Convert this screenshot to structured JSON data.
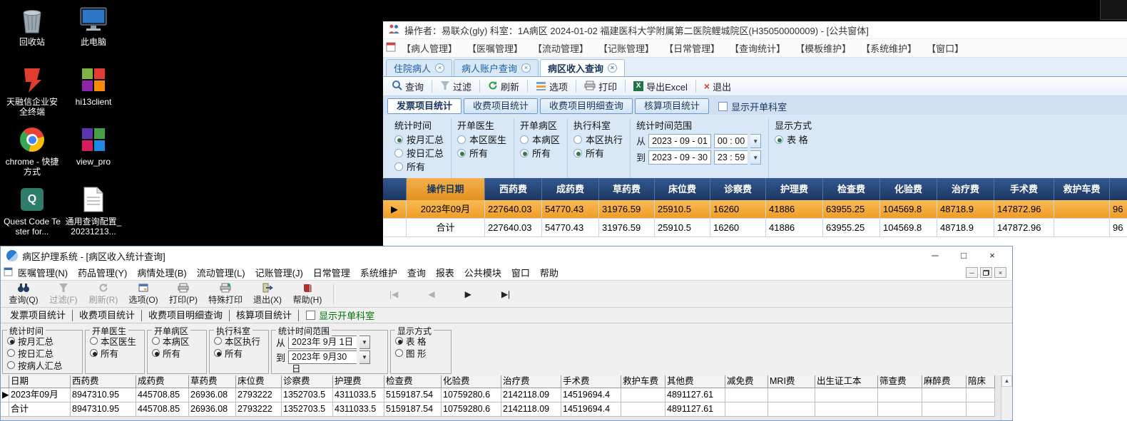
{
  "colors": {
    "header_navy": "#1c3763",
    "highlight_orange": "#f5a733",
    "checkbox_green": "#007700",
    "tab_blue": "#1a5fa8",
    "desktop_background": "#000000"
  },
  "desktop": {
    "icons": [
      {
        "label": "回收站"
      },
      {
        "label": "此电脑"
      },
      {
        "label": "天融信企业安全终端"
      },
      {
        "label": "hi13client"
      },
      {
        "label": "chrome - 快捷方式"
      },
      {
        "label": "view_pro"
      },
      {
        "label": "Quest Code Tester for..."
      },
      {
        "label": "通用查询配置_20231213..."
      }
    ]
  },
  "top_window": {
    "title": "操作者：易联众(gly)  科室：1A病区  2024-01-02  福建医科大学附属第二医院鲤城院区(H35050000009) - [公共窗体]",
    "menu": [
      "【病人管理】",
      "【医嘱管理】",
      "【流动管理】",
      "【记账管理】",
      "【日常管理】",
      "【查询统计】",
      "【模板维护】",
      "【系统维护】",
      "【窗口】"
    ],
    "tabs": [
      {
        "label": "住院病人"
      },
      {
        "label": "病人账户查询"
      },
      {
        "label": "病区收入查询"
      }
    ],
    "active_tab": "病区收入查询",
    "toolbar": {
      "query": "查询",
      "filter": "过滤",
      "refresh": "刷新",
      "options": "选项",
      "print": "打印",
      "export": "导出Excel",
      "exit": "退出"
    },
    "subtabs": [
      "发票项目统计",
      "收费项目统计",
      "收费项目明细查询",
      "核算项目统计"
    ],
    "active_subtab": "发票项目统计",
    "show_dept_label": "显示开单科室",
    "filters": {
      "stat_time": {
        "title": "统计时间",
        "options": [
          "按月汇总",
          "按日汇总",
          "所有"
        ],
        "selected": "按月汇总"
      },
      "doctor": {
        "title": "开单医生",
        "options": [
          "本区医生",
          "所有"
        ],
        "selected": "所有"
      },
      "ward": {
        "title": "开单病区",
        "options": [
          "本病区",
          "所有"
        ],
        "selected": "所有"
      },
      "exec_dept": {
        "title": "执行科室",
        "options": [
          "本区执行",
          "所有"
        ],
        "selected": "所有"
      },
      "time_range": {
        "title": "统计时间范围",
        "from_label": "从",
        "from_date": "2023 - 09 - 01",
        "from_time": "00 : 00",
        "to_label": "到",
        "to_date": "2023 - 09 - 30",
        "to_time": "23 : 59"
      },
      "display": {
        "title": "显示方式",
        "options": [
          "表   格"
        ],
        "selected": "表   格"
      }
    },
    "table": {
      "columns": [
        "操作日期",
        "西药费",
        "成药费",
        "草药费",
        "床位费",
        "诊察费",
        "护理费",
        "检查费",
        "化验费",
        "治疗费",
        "手术费",
        "救护车费",
        "其"
      ],
      "rows": [
        {
          "label": "2023年09月",
          "values": [
            "227640.03",
            "54770.43",
            "31976.59",
            "25910.5",
            "16260",
            "41886",
            "63955.25",
            "104569.8",
            "48718.9",
            "147872.96",
            "",
            "96"
          ]
        },
        {
          "label": "合计",
          "values": [
            "227640.03",
            "54770.43",
            "31976.59",
            "25910.5",
            "16260",
            "41886",
            "63955.25",
            "104569.8",
            "48718.9",
            "147872.96",
            "",
            "96"
          ]
        }
      ]
    }
  },
  "bottom_window": {
    "title": "病区护理系统 - [病区收入统计查询]",
    "menu": [
      "医嘱管理(N)",
      "药品管理(Y)",
      "病情处理(B)",
      "流动管理(L)",
      "记账管理(J)",
      "日常管理",
      "系统维护",
      "查询",
      "报表",
      "公共模块",
      "窗口",
      "帮助"
    ],
    "toolbar": [
      {
        "label": "查询(Q)",
        "enabled": true
      },
      {
        "label": "过滤(F)",
        "enabled": false
      },
      {
        "label": "刷新(R)",
        "enabled": false
      },
      {
        "label": "选项(O)",
        "enabled": true
      },
      {
        "label": "打印(P)",
        "enabled": true
      },
      {
        "label": "特殊打印",
        "enabled": true
      },
      {
        "label": "退出(X)",
        "enabled": true
      },
      {
        "label": "帮助(H)",
        "enabled": true
      }
    ],
    "subtabs": [
      "发票项目统计",
      "收费项目统计",
      "收费项目明细查询",
      "核算项目统计"
    ],
    "show_dept_label": "显示开单科室",
    "filters": {
      "stat_time": {
        "title": "统计时间",
        "options": [
          "按月汇总",
          "按日汇总",
          "按病人汇总"
        ],
        "selected": "按月汇总"
      },
      "doctor": {
        "title": "开单医生",
        "options": [
          "本区医生",
          "所有"
        ],
        "selected": "所有"
      },
      "ward": {
        "title": "开单病区",
        "options": [
          "本病区",
          "所有"
        ],
        "selected": "所有"
      },
      "exec_dept": {
        "title": "执行科室",
        "options": [
          "本区执行",
          "所有"
        ],
        "selected": "所有"
      },
      "time_range": {
        "title": "统计时间范围",
        "from_label": "从",
        "from_date": "2023年 9月 1日",
        "to_label": "到",
        "to_date": "2023年 9月30日"
      },
      "display": {
        "title": "显示方式",
        "options": [
          "表  格",
          "图  形"
        ],
        "selected": "表  格"
      }
    },
    "table": {
      "columns": [
        "日期",
        "西药费",
        "成药费",
        "草药费",
        "床位费",
        "诊察费",
        "护理费",
        "检查费",
        "化验费",
        "治疗费",
        "手术费",
        "救护车费",
        "其他费",
        "减免费",
        "MRI费",
        "出生证工本",
        "筛查费",
        "麻醉费",
        "陪床"
      ],
      "rows": [
        {
          "label": "2023年09月",
          "values": [
            "8947310.95",
            "445708.85",
            "26936.08",
            "2793222",
            "1352703.5",
            "4311033.5",
            "5159187.54",
            "10759280.6",
            "2142118.09",
            "14519694.4",
            "",
            "4891127.61",
            "",
            "",
            "",
            "",
            "",
            ""
          ]
        },
        {
          "label": "合计",
          "values": [
            "8947310.95",
            "445708.85",
            "26936.08",
            "2793222",
            "1352703.5",
            "4311033.5",
            "5159187.54",
            "10759280.6",
            "2142118.09",
            "14519694.4",
            "",
            "4891127.61",
            "",
            "",
            "",
            "",
            "",
            ""
          ]
        }
      ]
    }
  }
}
